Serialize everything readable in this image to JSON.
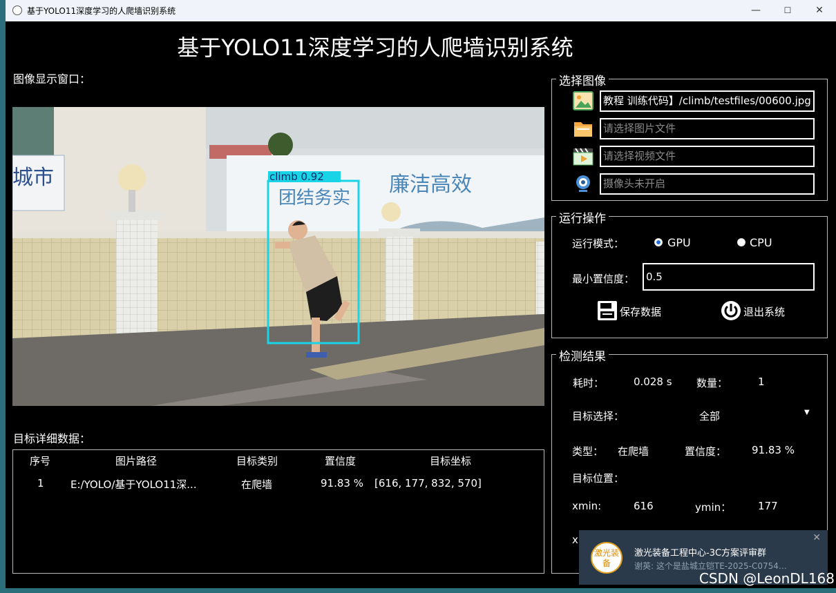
{
  "window": {
    "title": "基于YOLO11深度学习的人爬墙识别系统",
    "minimize": "—",
    "maximize": "☐",
    "close": "✕"
  },
  "app_title": "基于YOLO11深度学习的人爬墙识别系统",
  "image_panel": {
    "label": "图像显示窗口：",
    "detection_label": "climb  0.92",
    "sign_text_left": "城市",
    "banner_text_1": "团结务实",
    "banner_text_2": "廉洁高效"
  },
  "details": {
    "label": "目标详细数据：",
    "columns": [
      "序号",
      "图片路径",
      "目标类别",
      "置信度",
      "目标坐标"
    ],
    "rows": [
      [
        "1",
        "E:/YOLO/基于YOLO11深...",
        "在爬墙",
        "91.83 %",
        "[616, 177, 832, 570]"
      ]
    ]
  },
  "select_image": {
    "title": "选择图像",
    "image_path": "教程 训练代码】/climb/testfiles/00600.jpg",
    "folder_placeholder": "请选择图片文件",
    "video_placeholder": "请选择视频文件",
    "camera_placeholder": "摄像头未开启"
  },
  "operations": {
    "title": "运行操作",
    "mode_label": "运行模式：",
    "gpu_label": "GPU",
    "cpu_label": "CPU",
    "selected_mode": "GPU",
    "conf_label": "最小置信度：",
    "conf_value": "0.5",
    "save_label": "保存数据",
    "exit_label": "退出系统"
  },
  "results": {
    "title": "检测结果",
    "time_label": "耗时：",
    "time_value": "0.028 s",
    "count_label": "数量：",
    "count_value": "1",
    "target_select_label": "目标选择：",
    "target_select_value": "全部",
    "type_label": "类型：",
    "type_value": "在爬墙",
    "conf_label": "置信度：",
    "conf_value": "91.83 %",
    "position_label": "目标位置：",
    "xmin_label": "xmin:",
    "xmin_value": "616",
    "ymin_label": "ymin：",
    "ymin_value": "177",
    "xmax_partial": "x"
  },
  "notification": {
    "logo_text": "激光装备",
    "title": "激光装备工程中心-3C方案评审群",
    "body": "谢英: 这个是盐城立铠TE-2025-C0754…",
    "close": "✕"
  },
  "watermark": "CSDN @LeonDL168",
  "colors": {
    "detection_box": "#19d4e6",
    "background": "#000000",
    "radio_selected": "#1f6fd6"
  }
}
